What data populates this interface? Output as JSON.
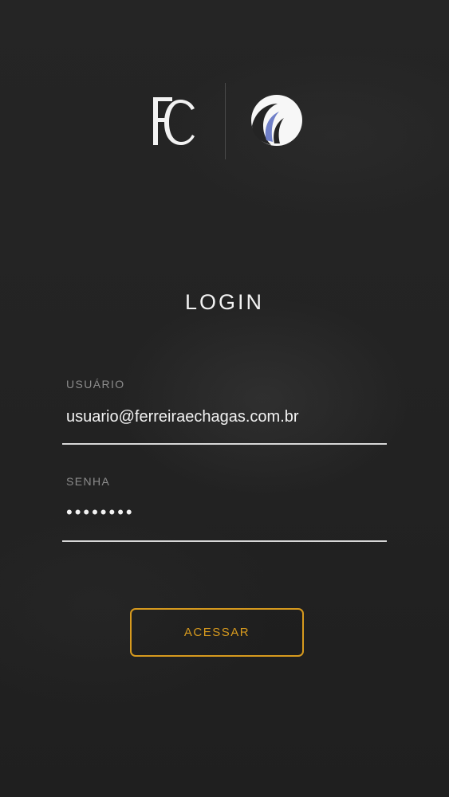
{
  "logos": {
    "left_logo_text": "FC",
    "right_logo_icon": "wave-circle-icon"
  },
  "login": {
    "title": "LOGIN",
    "username": {
      "label": "USUÁRIO",
      "value": "usuario@ferreiraechagas.com.br"
    },
    "password": {
      "label": "SENHA",
      "value": "••••••••"
    },
    "submit_label": "ACESSAR"
  },
  "colors": {
    "background": "#242424",
    "text": "#f2f2f2",
    "label": "#8c8c8c",
    "accent": "#d79a1e",
    "logo_blue": "#6f7fc8"
  }
}
